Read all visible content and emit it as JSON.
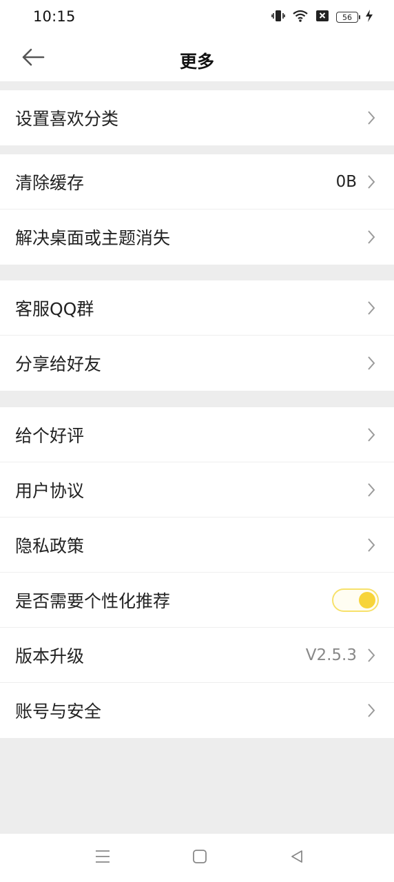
{
  "status_bar": {
    "time": "10:15",
    "battery_level": "56",
    "icons": [
      "vibrate-icon",
      "wifi-icon",
      "sim-off-icon",
      "battery-icon",
      "charging-icon"
    ]
  },
  "header": {
    "title": "更多",
    "back_icon": "arrow-left-icon"
  },
  "groups": [
    {
      "items": [
        {
          "label": "设置喜欢分类"
        }
      ]
    },
    {
      "items": [
        {
          "label": "清除缓存",
          "value": "0B"
        },
        {
          "label": "解决桌面或主题消失"
        }
      ]
    },
    {
      "items": [
        {
          "label": "客服QQ群"
        },
        {
          "label": "分享给好友"
        }
      ]
    },
    {
      "items": [
        {
          "label": "给个好评"
        },
        {
          "label": "用户协议"
        },
        {
          "label": "隐私政策"
        },
        {
          "label": "是否需要个性化推荐",
          "toggle_on": true
        },
        {
          "label": "版本升级",
          "value": "V2.5.3"
        },
        {
          "label": "账号与安全"
        }
      ]
    }
  ],
  "nav_bar": {
    "buttons": [
      "menu-icon",
      "home-square-icon",
      "back-triangle-icon"
    ]
  },
  "colors": {
    "toggle_accent": "#f7d43a",
    "background": "#ededed"
  }
}
